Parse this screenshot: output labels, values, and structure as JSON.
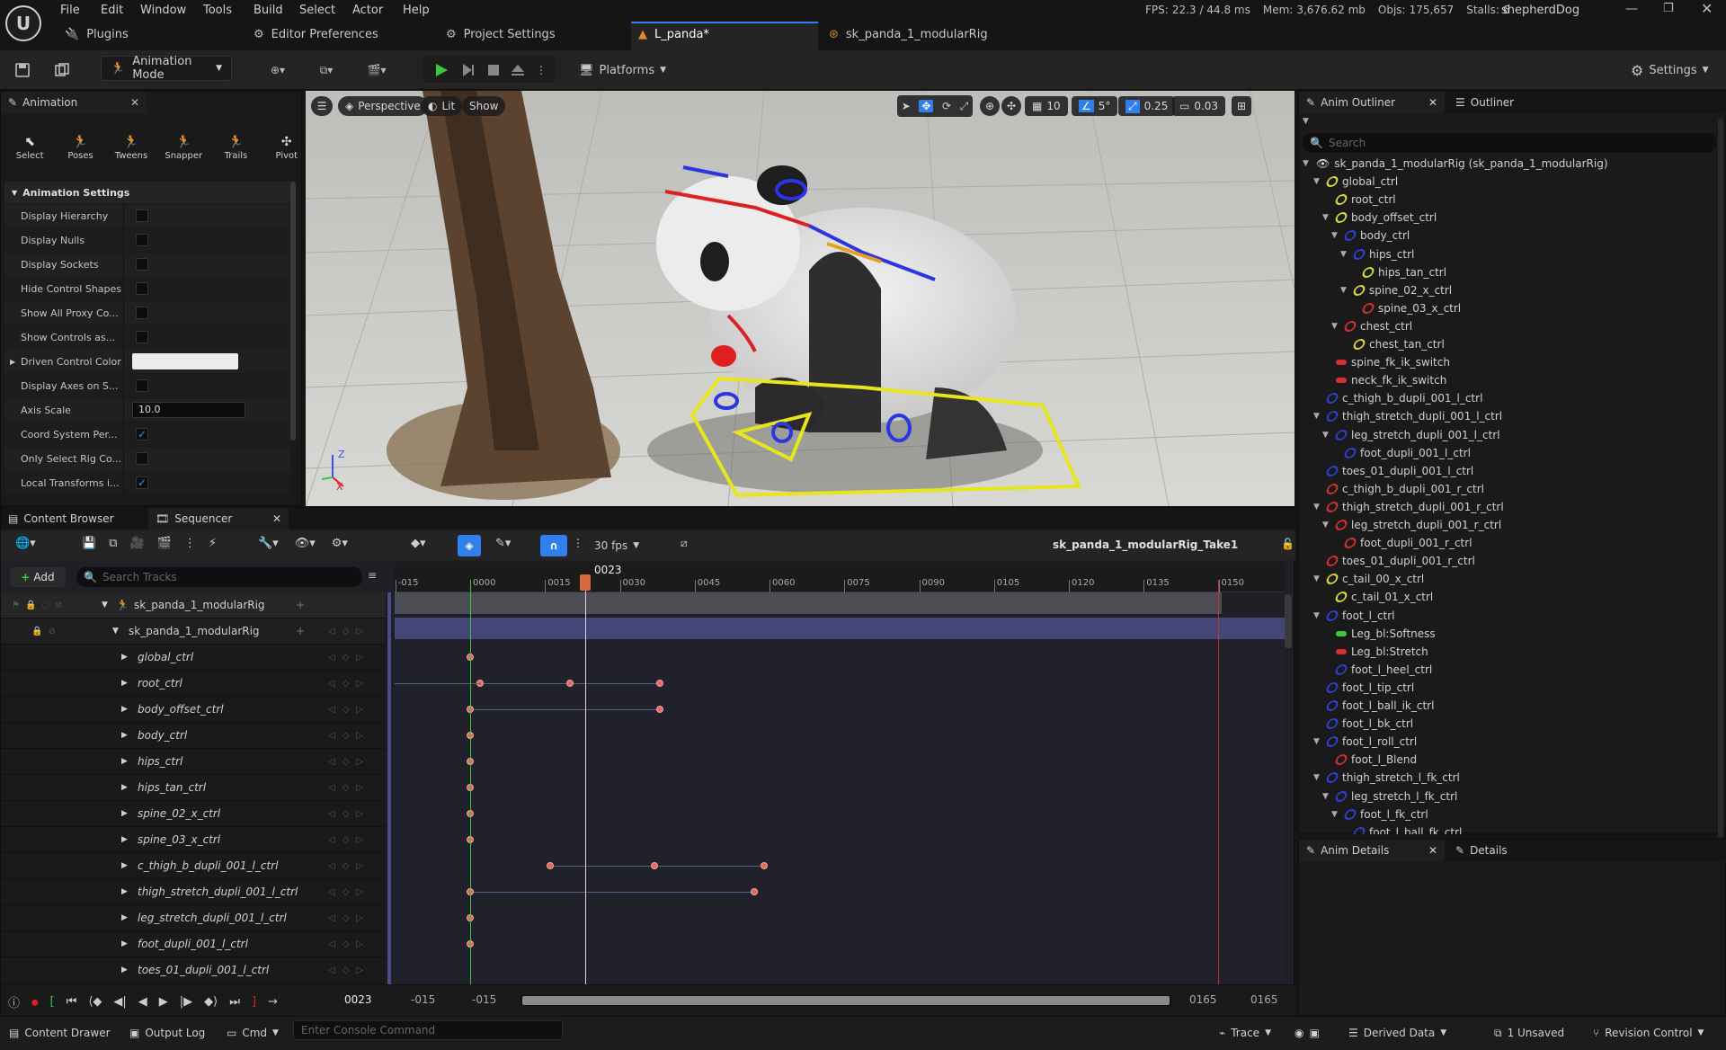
{
  "menubar": {
    "items": [
      "File",
      "Edit",
      "Window",
      "Tools",
      "Build",
      "Select",
      "Actor",
      "Help"
    ],
    "stats": {
      "fps_label": "FPS:",
      "fps": "22.3",
      "ms": "/ 44.8 ms",
      "mem_label": "Mem:",
      "mem": "3,676.62 mb",
      "objs_label": "Objs:",
      "objs": "175,657",
      "stalls_label": "Stalls:",
      "stalls": "6"
    },
    "project": "shepherdDog",
    "tabs": {
      "plugins": "Plugins",
      "editor_prefs": "Editor Preferences",
      "project_settings": "Project Settings",
      "level": "L_panda*",
      "rig": "sk_panda_1_modularRig"
    }
  },
  "toolbar": {
    "mode": "Animation Mode",
    "platforms": "Platforms",
    "settings": "Settings"
  },
  "animation_panel": {
    "tab": "Animation",
    "tools": [
      "Select",
      "Poses",
      "Tweens",
      "Snapper",
      "Trails",
      "Pivot"
    ],
    "section": "Animation Settings",
    "settings": [
      {
        "label": "Display Hierarchy",
        "checked": false
      },
      {
        "label": "Display Nulls",
        "checked": false
      },
      {
        "label": "Display Sockets",
        "checked": false
      },
      {
        "label": "Hide Control Shapes",
        "checked": false
      },
      {
        "label": "Show All Proxy Co...",
        "checked": false
      },
      {
        "label": "Show Controls as...",
        "checked": false
      },
      {
        "label": "Driven Control Color",
        "color": true
      },
      {
        "label": "Display Axes on S...",
        "checked": false
      },
      {
        "label": "Axis Scale",
        "value": "10.0"
      },
      {
        "label": "Coord System Per...",
        "checked": true
      },
      {
        "label": "Only Select Rig Co...",
        "checked": false
      },
      {
        "label": "Local Transforms i...",
        "checked": true
      }
    ]
  },
  "viewport": {
    "perspective": "Perspective",
    "lit": "Lit",
    "show": "Show",
    "grid": "10",
    "angle": "5°",
    "scale": "0.25",
    "camera": "0.03",
    "axis_z": "Z",
    "axis_x": "X"
  },
  "outliner": {
    "tabs": {
      "anim_outliner": "Anim Outliner",
      "outliner": "Outliner"
    },
    "search_placeholder": "Search",
    "root": "sk_panda_1_modularRig (sk_panda_1_modularRig)",
    "items": [
      {
        "label": "global_ctrl",
        "indent": 1,
        "caret": true,
        "color": "#d6d63a"
      },
      {
        "label": "root_ctrl",
        "indent": 2,
        "caret": false,
        "color": "#d6d63a"
      },
      {
        "label": "body_offset_ctrl",
        "indent": 2,
        "caret": true,
        "color": "#d6d63a"
      },
      {
        "label": "body_ctrl",
        "indent": 3,
        "caret": true,
        "color": "#2d3fd0"
      },
      {
        "label": "hips_ctrl",
        "indent": 4,
        "caret": true,
        "color": "#2d3fd0"
      },
      {
        "label": "hips_tan_ctrl",
        "indent": 5,
        "caret": false,
        "color": "#d6d63a"
      },
      {
        "label": "spine_02_x_ctrl",
        "indent": 4,
        "caret": true,
        "color": "#d6d63a"
      },
      {
        "label": "spine_03_x_ctrl",
        "indent": 5,
        "caret": false,
        "color": "#d03030"
      },
      {
        "label": "chest_ctrl",
        "indent": 3,
        "caret": true,
        "color": "#d03030"
      },
      {
        "label": "chest_tan_ctrl",
        "indent": 4,
        "caret": false,
        "color": "#d6d63a"
      },
      {
        "label": "spine_fk_ik_switch",
        "indent": 2,
        "caret": false,
        "color": "#d03030",
        "bar": true
      },
      {
        "label": "neck_fk_ik_switch",
        "indent": 2,
        "caret": false,
        "color": "#d03030",
        "bar": true
      },
      {
        "label": "c_thigh_b_dupli_001_l_ctrl",
        "indent": 1,
        "caret": false,
        "color": "#2d3fd0"
      },
      {
        "label": "thigh_stretch_dupli_001_l_ctrl",
        "indent": 1,
        "caret": true,
        "color": "#2d3fd0"
      },
      {
        "label": "leg_stretch_dupli_001_l_ctrl",
        "indent": 2,
        "caret": true,
        "color": "#2d3fd0"
      },
      {
        "label": "foot_dupli_001_l_ctrl",
        "indent": 3,
        "caret": false,
        "color": "#2d3fd0"
      },
      {
        "label": "toes_01_dupli_001_l_ctrl",
        "indent": 1,
        "caret": false,
        "color": "#2d3fd0"
      },
      {
        "label": "c_thigh_b_dupli_001_r_ctrl",
        "indent": 1,
        "caret": false,
        "color": "#d03030"
      },
      {
        "label": "thigh_stretch_dupli_001_r_ctrl",
        "indent": 1,
        "caret": true,
        "color": "#d03030"
      },
      {
        "label": "leg_stretch_dupli_001_r_ctrl",
        "indent": 2,
        "caret": true,
        "color": "#d03030"
      },
      {
        "label": "foot_dupli_001_r_ctrl",
        "indent": 3,
        "caret": false,
        "color": "#d03030"
      },
      {
        "label": "toes_01_dupli_001_r_ctrl",
        "indent": 1,
        "caret": false,
        "color": "#d03030"
      },
      {
        "label": "c_tail_00_x_ctrl",
        "indent": 1,
        "caret": true,
        "color": "#d6d63a"
      },
      {
        "label": "c_tail_01_x_ctrl",
        "indent": 2,
        "caret": false,
        "color": "#d6d63a"
      },
      {
        "label": "foot_l_ctrl",
        "indent": 1,
        "caret": true,
        "color": "#2d3fd0"
      },
      {
        "label": "Leg_bl:Softness",
        "indent": 2,
        "caret": false,
        "color": "#3cc83c",
        "bar": true
      },
      {
        "label": "Leg_bl:Stretch",
        "indent": 2,
        "caret": false,
        "color": "#d03030",
        "bar": true
      },
      {
        "label": "foot_l_heel_ctrl",
        "indent": 2,
        "caret": false,
        "color": "#2d3fd0"
      },
      {
        "label": "foot_l_tip_ctrl",
        "indent": 1,
        "caret": false,
        "color": "#2d3fd0"
      },
      {
        "label": "foot_l_ball_ik_ctrl",
        "indent": 1,
        "caret": false,
        "color": "#2d3fd0"
      },
      {
        "label": "foot_l_bk_ctrl",
        "indent": 1,
        "caret": false,
        "color": "#2d3fd0"
      },
      {
        "label": "foot_l_roll_ctrl",
        "indent": 1,
        "caret": true,
        "color": "#2d3fd0"
      },
      {
        "label": "foot_l_Blend",
        "indent": 2,
        "caret": false,
        "color": "#d03030"
      },
      {
        "label": "thigh_stretch_l_fk_ctrl",
        "indent": 1,
        "caret": true,
        "color": "#2d3fd0"
      },
      {
        "label": "leg_stretch_l_fk_ctrl",
        "indent": 2,
        "caret": true,
        "color": "#2d3fd0"
      },
      {
        "label": "foot_l_fk_ctrl",
        "indent": 3,
        "caret": true,
        "color": "#2d3fd0"
      },
      {
        "label": "foot_l_ball_fk_ctrl",
        "indent": 4,
        "caret": false,
        "color": "#2d3fd0"
      }
    ]
  },
  "details": {
    "anim_details": "Anim Details",
    "details": "Details"
  },
  "sequencer": {
    "tabs": {
      "content_browser": "Content Browser",
      "sequencer": "Sequencer"
    },
    "fps": "30 fps",
    "sequence_name": "sk_panda_1_modularRig_Take1",
    "add": "Add",
    "search_placeholder": "Search Tracks",
    "current_frame": "0023",
    "ruler": [
      "-015",
      "0000",
      "0015",
      "0030",
      "0045",
      "0060",
      "0075",
      "0090",
      "0105",
      "0120",
      "0135",
      "0150"
    ],
    "root_track": "sk_panda_1_modularRig",
    "sub_track": "sk_panda_1_modularRig",
    "tracks": [
      "global_ctrl",
      "root_ctrl",
      "body_offset_ctrl",
      "body_ctrl",
      "hips_ctrl",
      "hips_tan_ctrl",
      "spine_02_x_ctrl",
      "spine_03_x_ctrl",
      "c_thigh_b_dupli_001_l_ctrl",
      "thigh_stretch_dupli_001_l_ctrl",
      "leg_stretch_dupli_001_l_ctrl",
      "foot_dupli_001_l_ctrl",
      "toes_01_dupli_001_l_ctrl"
    ],
    "keys": [
      {
        "track": 1,
        "frames": [
          0
        ]
      },
      {
        "track": 2,
        "frames": [
          2,
          20,
          38
        ]
      },
      {
        "track": 3,
        "frames": [
          0,
          38
        ]
      },
      {
        "track": 4,
        "frames": [
          0
        ]
      },
      {
        "track": 5,
        "frames": [
          0
        ]
      },
      {
        "track": 6,
        "frames": [
          0
        ]
      },
      {
        "track": 7,
        "frames": [
          0
        ]
      },
      {
        "track": 8,
        "frames": [
          0
        ]
      },
      {
        "track": 9,
        "frames": [
          16,
          37,
          59
        ]
      },
      {
        "track": 10,
        "frames": [
          0,
          57
        ]
      },
      {
        "track": 11,
        "frames": [
          0
        ]
      },
      {
        "track": 12,
        "frames": [
          0
        ]
      }
    ],
    "playback": {
      "frame": "0023",
      "start_view": "-015",
      "start_work": "-015",
      "end_work": "0165",
      "end_view": "0165"
    }
  },
  "statusbar": {
    "content_drawer": "Content Drawer",
    "output_log": "Output Log",
    "cmd": "Cmd",
    "console_placeholder": "Enter Console Command",
    "trace": "Trace",
    "derived_data": "Derived Data",
    "unsaved": "1 Unsaved",
    "revision": "Revision Control"
  }
}
